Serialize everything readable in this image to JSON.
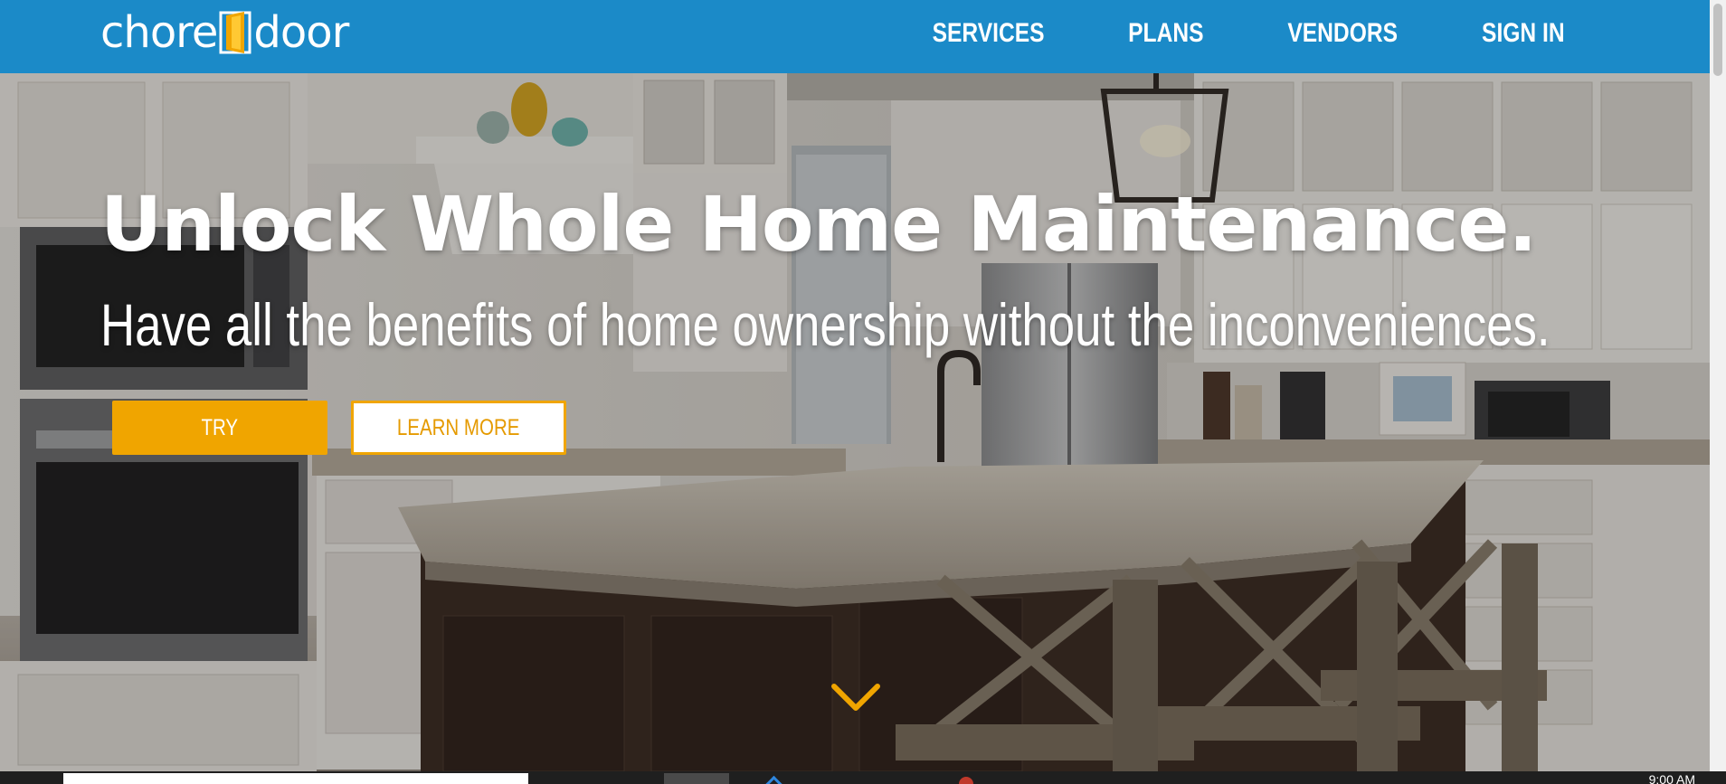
{
  "brand": {
    "name_part1": "chore",
    "name_part2": "door",
    "header_color": "#1b8ac8",
    "accent_color": "#f0a500"
  },
  "nav": {
    "items": [
      {
        "label": "SERVICES"
      },
      {
        "label": "PLANS"
      },
      {
        "label": "VENDORS"
      },
      {
        "label": "SIGN IN"
      }
    ]
  },
  "hero": {
    "title": "Unlock Whole Home Maintenance.",
    "subtitle": "Have all the benefits of home ownership without the inconveniences.",
    "try_label": "TRY",
    "learn_more_label": "LEARN MORE",
    "scroll_icon": "chevron-down-icon"
  },
  "taskbar": {
    "time": "9:00 AM"
  }
}
